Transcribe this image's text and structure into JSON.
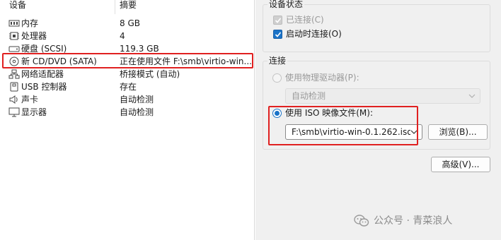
{
  "device_list": {
    "header_device": "设备",
    "header_summary": "摘要",
    "rows": [
      {
        "device": "内存",
        "summary": "8 GB",
        "icon": "memory-icon"
      },
      {
        "device": "处理器",
        "summary": "4",
        "icon": "cpu-icon"
      },
      {
        "device": "硬盘 (SCSI)",
        "summary": "119.3 GB",
        "icon": "hard-disk-icon"
      },
      {
        "device": "新 CD/DVD (SATA)",
        "summary": "正在使用文件 F:\\smb\\virtio-win...",
        "icon": "cd-dvd-icon"
      },
      {
        "device": "网络适配器",
        "summary": "桥接模式 (自动)",
        "icon": "network-adapter-icon"
      },
      {
        "device": "USB 控制器",
        "summary": "存在",
        "icon": "usb-icon"
      },
      {
        "device": "声卡",
        "summary": "自动检测",
        "icon": "sound-card-icon"
      },
      {
        "device": "显示器",
        "summary": "自动检测",
        "icon": "display-icon"
      }
    ]
  },
  "device_status": {
    "title": "设备状态",
    "connected_label": "已连接(C)",
    "connect_on_power_label": "启动时连接(O)"
  },
  "connection": {
    "title": "连接",
    "physical_drive_label": "使用物理驱动器(P):",
    "physical_drive_value": "自动检测",
    "iso_label": "使用 ISO 映像文件(M):",
    "iso_path": "F:\\smb\\virtio-win-0.1.262.iso",
    "browse_label": "浏览(B)..."
  },
  "advanced_label": "高级(V)...",
  "watermark": "公众号 · 青菜浪人",
  "colors": {
    "highlight_red": "#e02020",
    "accent_blue": "#1a73c8"
  }
}
